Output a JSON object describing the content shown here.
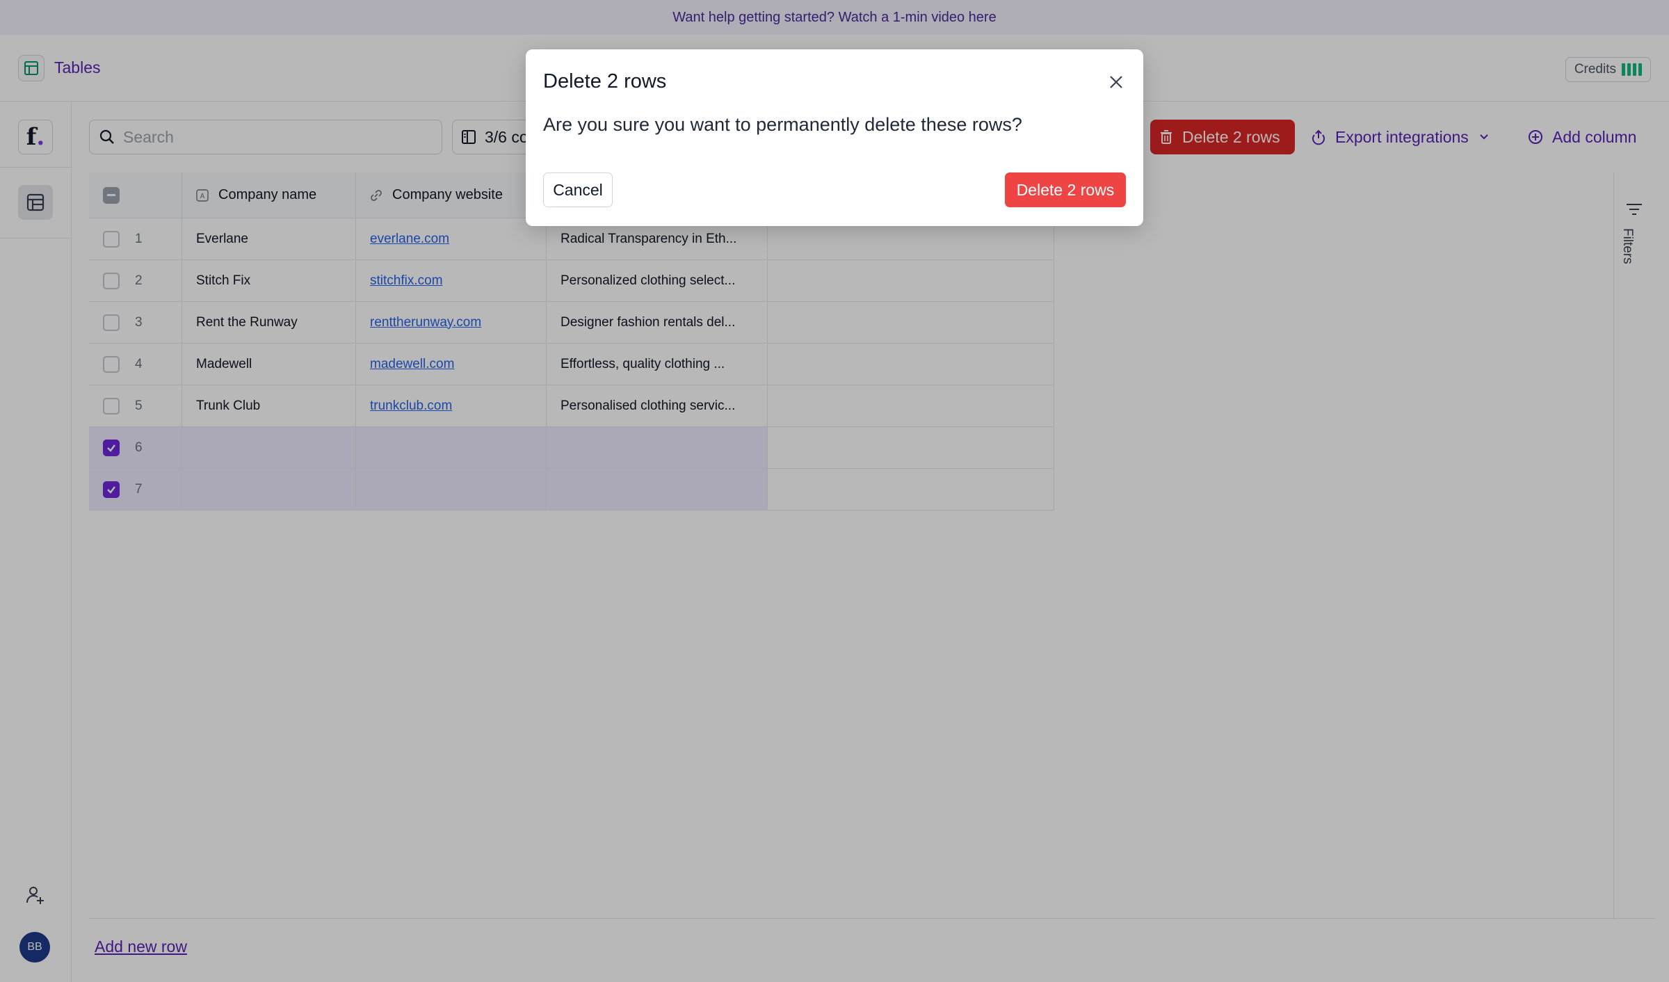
{
  "banner": {
    "text": "Want help getting started? Watch a 1-min video here"
  },
  "topbar": {
    "title": "Tables",
    "credits_label": "Credits"
  },
  "rail": {
    "logo_letter": "f",
    "logo_dot": ".",
    "avatar_initials": "BB"
  },
  "toolbar": {
    "search_placeholder": "Search",
    "columns_label": "3/6 co",
    "delete_label": "Delete 2 rows",
    "export_label": "Export integrations",
    "add_column_label": "Add column"
  },
  "table": {
    "headers": [
      "Company name",
      "Company website"
    ],
    "rows": [
      {
        "num": "1",
        "name": "Everlane",
        "website": "everlane.com",
        "description": "Radical Transparency in Eth...",
        "selected": false
      },
      {
        "num": "2",
        "name": "Stitch Fix",
        "website": "stitchfix.com",
        "description": "Personalized clothing select...",
        "selected": false
      },
      {
        "num": "3",
        "name": "Rent the Runway",
        "website": "renttherunway.com",
        "description": "Designer fashion rentals del...",
        "selected": false
      },
      {
        "num": "4",
        "name": "Madewell",
        "website": "madewell.com",
        "description": "Effortless, quality clothing ...",
        "selected": false
      },
      {
        "num": "5",
        "name": "Trunk Club",
        "website": "trunkclub.com",
        "description": "Personalised clothing servic...",
        "selected": false
      },
      {
        "num": "6",
        "name": "",
        "website": "",
        "description": "",
        "selected": true
      },
      {
        "num": "7",
        "name": "",
        "website": "",
        "description": "",
        "selected": true
      }
    ]
  },
  "filters": {
    "label": "Filters"
  },
  "footer": {
    "add_row_label": "Add new row"
  },
  "modal": {
    "title": "Delete 2 rows",
    "body": "Are you sure you want to permanently delete these rows?",
    "cancel_label": "Cancel",
    "confirm_label": "Delete 2 rows"
  },
  "colors": {
    "accent": "#5b21b6",
    "danger": "#ef4444",
    "link": "#2563eb",
    "credits": "#10b981"
  }
}
